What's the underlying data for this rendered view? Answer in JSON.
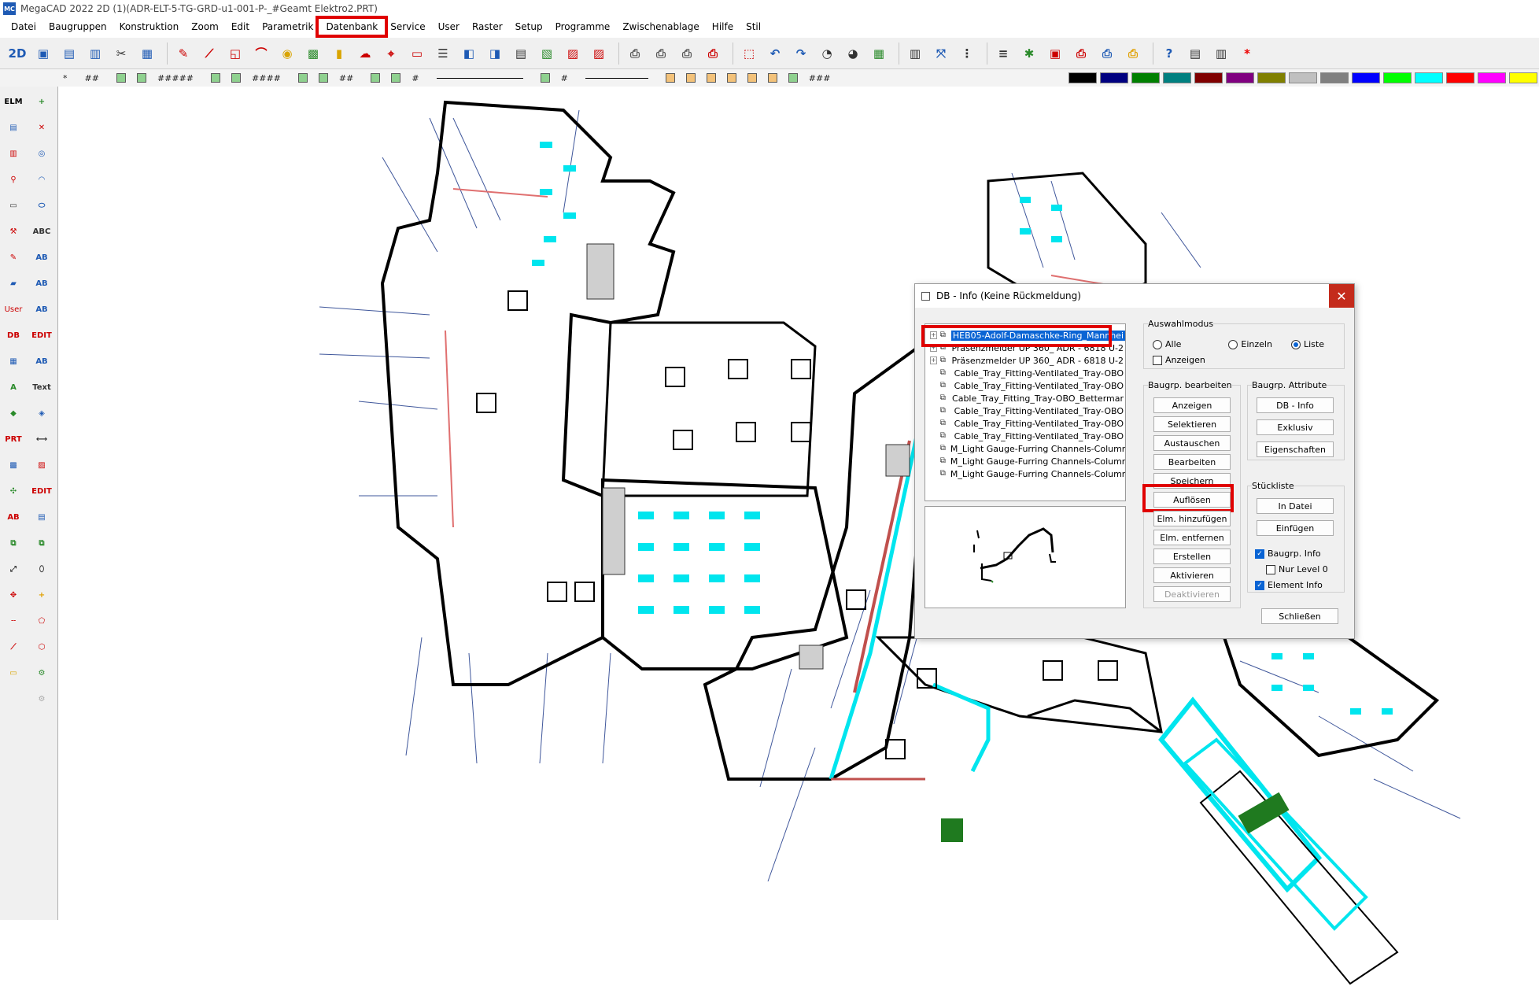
{
  "window": {
    "title": "MegaCAD 2022 2D (1)(ADR-ELT-5-TG-GRD-u1-001-P-_#Geamt Elektro2.PRT)"
  },
  "menu": [
    "Datei",
    "Baugruppen",
    "Konstruktion",
    "Zoom",
    "Edit",
    "Parametrik",
    "Datenbank",
    "Service",
    "User",
    "Raster",
    "Setup",
    "Programme",
    "Zwischenablage",
    "Hilfe",
    "Stil"
  ],
  "menu_highlighted": "Datenbank",
  "toolbar2": {
    "fields": [
      "*",
      "##",
      "#####",
      "####",
      "##",
      "#",
      "#",
      "###"
    ]
  },
  "colors": {
    "palette": [
      "#000000",
      "#000080",
      "#008000",
      "#008080",
      "#800000",
      "#800080",
      "#808000",
      "#c0c0c0",
      "#808080",
      "#0000ff",
      "#00ff00",
      "#00ffff",
      "#ff0000",
      "#ff00ff",
      "#ffff00"
    ],
    "highlight": "#e00000",
    "selection": "#0a64d4",
    "cyan": "#00e5ee"
  },
  "dialog": {
    "title": "DB - Info (Keine Rückmeldung)",
    "tree": [
      {
        "label": "HEB05-Adolf-Damaschke-Ring_Mannhei",
        "selected": true
      },
      {
        "label": "Präsenzmelder UP 360_ ADR - 6818 U-2",
        "selected": false
      },
      {
        "label": "Präsenzmelder UP 360_ ADR - 6818 U-2",
        "selected": false
      },
      {
        "label": "Cable_Tray_Fitting-Ventilated_Tray-OBO",
        "selected": false
      },
      {
        "label": "Cable_Tray_Fitting-Ventilated_Tray-OBO",
        "selected": false
      },
      {
        "label": "Cable_Tray_Fitting_Tray-OBO_Bettermar",
        "selected": false
      },
      {
        "label": "Cable_Tray_Fitting-Ventilated_Tray-OBO",
        "selected": false
      },
      {
        "label": "Cable_Tray_Fitting-Ventilated_Tray-OBO",
        "selected": false
      },
      {
        "label": "Cable_Tray_Fitting-Ventilated_Tray-OBO",
        "selected": false
      },
      {
        "label": "M_Light Gauge-Furring Channels-Column",
        "selected": false
      },
      {
        "label": "M_Light Gauge-Furring Channels-Column",
        "selected": false
      },
      {
        "label": "M_Light Gauge-Furring Channels-Column",
        "selected": false
      }
    ],
    "auswahlmodus": {
      "title": "Auswahlmodus",
      "options": [
        {
          "label": "Alle",
          "checked": false
        },
        {
          "label": "Einzeln",
          "checked": false
        },
        {
          "label": "Liste",
          "checked": true
        }
      ],
      "anzeigen": {
        "label": "Anzeigen",
        "checked": false
      }
    },
    "bearbeiten": {
      "title": "Baugrp. bearbeiten",
      "buttons": [
        {
          "label": "Anzeigen",
          "enabled": true
        },
        {
          "label": "Selektieren",
          "enabled": true
        },
        {
          "label": "Austauschen",
          "enabled": true
        },
        {
          "label": "Bearbeiten",
          "enabled": true
        },
        {
          "label": "Speichern",
          "enabled": true
        },
        {
          "label": "Auflösen",
          "enabled": true,
          "highlighted": true
        },
        {
          "label": "Elm. hinzufügen",
          "enabled": true
        },
        {
          "label": "Elm. entfernen",
          "enabled": true
        },
        {
          "label": "Erstellen",
          "enabled": true
        },
        {
          "label": "Aktivieren",
          "enabled": true
        },
        {
          "label": "Deaktivieren",
          "enabled": false
        }
      ]
    },
    "attribute": {
      "title": "Baugrp. Attribute",
      "buttons": [
        "DB - Info",
        "Exklusiv",
        "Eigenschaften"
      ]
    },
    "stueckliste": {
      "title": "Stückliste",
      "buttons": [
        "In Datei",
        "Einfügen"
      ],
      "checks": [
        {
          "label": "Baugrp. Info",
          "checked": true
        },
        {
          "label": "Nur Level 0",
          "checked": false
        },
        {
          "label": "Element Info",
          "checked": true
        }
      ]
    },
    "close_label": "Schließen"
  }
}
